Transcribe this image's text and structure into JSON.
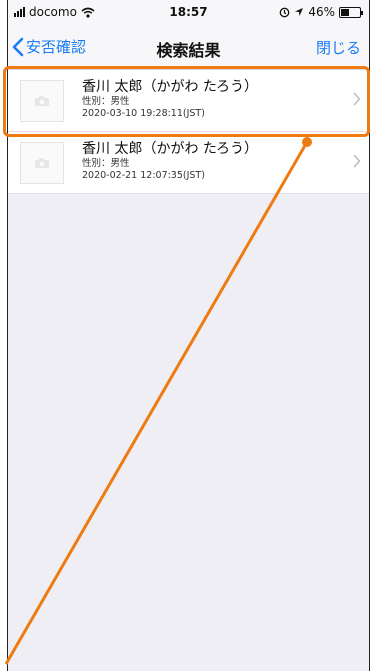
{
  "status_bar": {
    "carrier": "docomo",
    "time": "18:57",
    "battery_percent": "46%",
    "battery_level": 0.46
  },
  "nav": {
    "back_label": "安否確認",
    "title": "検索結果",
    "close_label": "閉じる"
  },
  "results": [
    {
      "name": "香川 太郎（かがわ たろう）",
      "sex": "性別：男性",
      "datetime": "2020-03-10 19:28:11(JST)"
    },
    {
      "name": "香川 太郎（かがわ たろう）",
      "sex": "性別：男性",
      "datetime": "2020-02-21 12:07:35(JST)"
    }
  ],
  "colors": {
    "accent": "#1a7cf5",
    "annotation": "#f07a12",
    "background": "#f0eef5"
  },
  "icons": [
    "wifi-icon",
    "signal-icon",
    "alarm-icon",
    "location-arrow-icon",
    "battery-icon",
    "chevron-left-icon",
    "camera-icon",
    "chevron-right-icon"
  ]
}
